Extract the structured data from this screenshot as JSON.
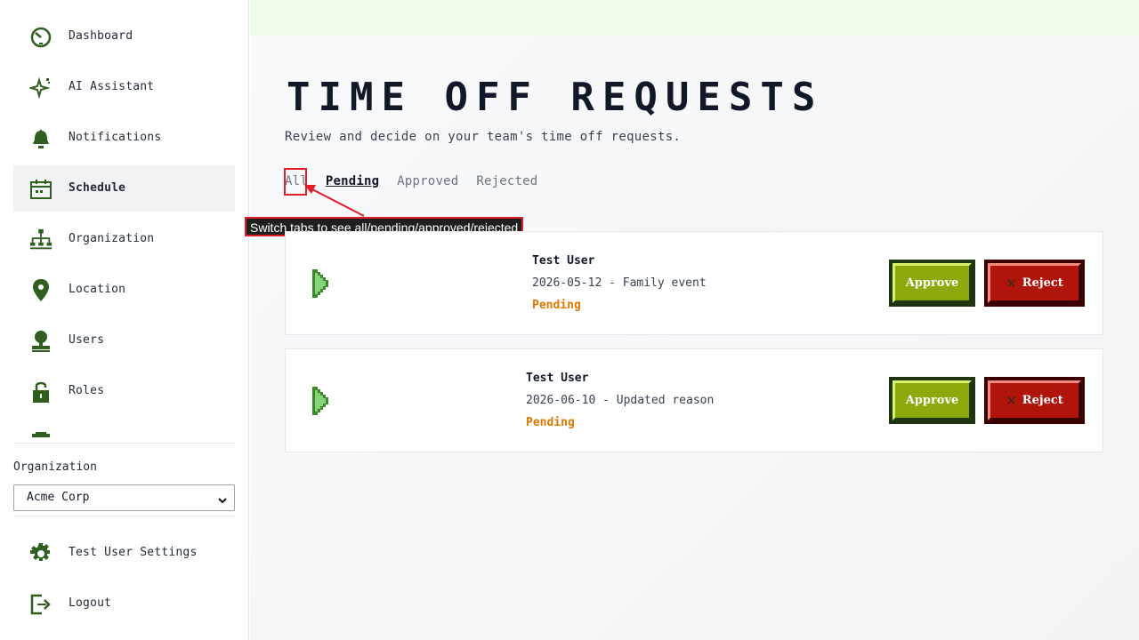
{
  "sidebar": {
    "items": [
      {
        "label": "Dashboard",
        "icon": "dashboard-icon"
      },
      {
        "label": "AI Assistant",
        "icon": "sparkle-icon"
      },
      {
        "label": "Notifications",
        "icon": "bell-icon"
      },
      {
        "label": "Schedule",
        "icon": "calendar-icon",
        "active": true
      },
      {
        "label": "Organization",
        "icon": "org-chart-icon"
      },
      {
        "label": "Location",
        "icon": "location-pin-icon"
      },
      {
        "label": "Users",
        "icon": "user-icon"
      },
      {
        "label": "Roles",
        "icon": "lock-icon"
      }
    ],
    "org_label": "Organization",
    "org_selected": "Acme Corp",
    "settings_label": "Test User Settings",
    "logout_label": "Logout"
  },
  "main": {
    "title": "TIME OFF REQUESTS",
    "subtitle": "Review and decide on your team's time off requests.",
    "tabs": [
      {
        "label": "All"
      },
      {
        "label": "Pending",
        "active": true
      },
      {
        "label": "Approved"
      },
      {
        "label": "Rejected"
      }
    ],
    "callout": "Switch tabs to see all/pending/approved/rejected",
    "requests": [
      {
        "name": "Test User",
        "detail": "2026-05-12 - Family event",
        "status": "Pending",
        "approve": "Approve",
        "reject": "Reject"
      },
      {
        "name": "Test User",
        "detail": "2026-06-10 - Updated reason",
        "status": "Pending",
        "approve": "Approve",
        "reject": "Reject"
      }
    ]
  },
  "colors": {
    "accent_green": "#2f5e1f",
    "approve": "#8aaa0e",
    "reject": "#b1140b",
    "pending": "#e07800",
    "annotation": "#e11d2a"
  }
}
